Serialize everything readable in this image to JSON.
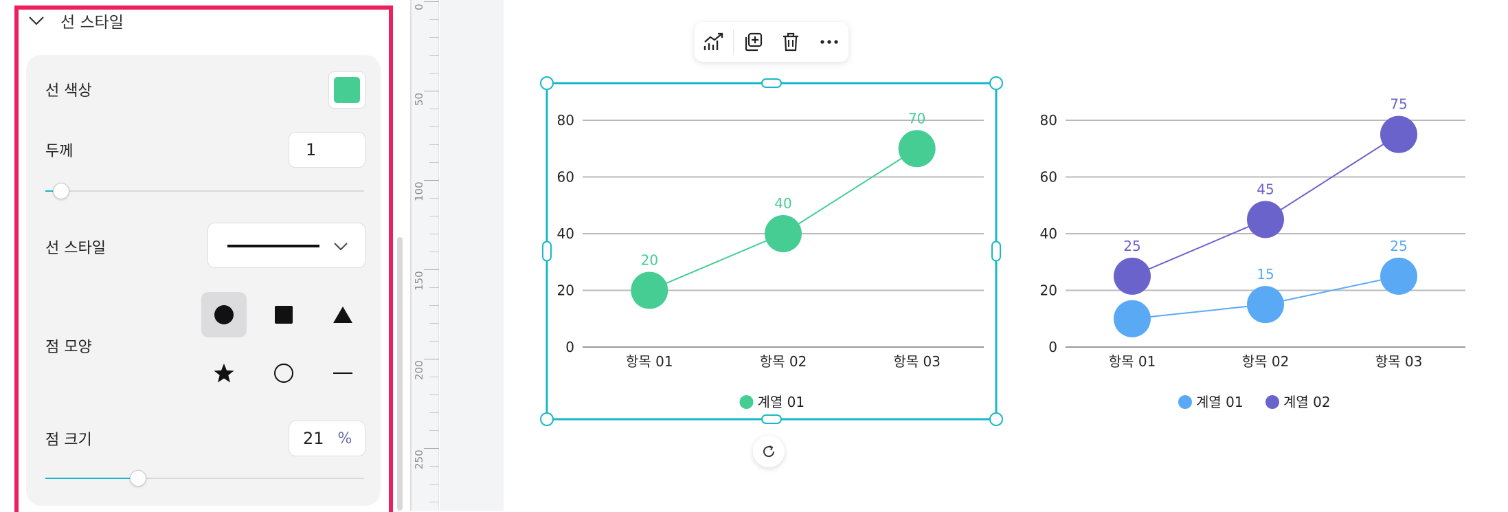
{
  "panel": {
    "section_title": "선 스타일",
    "line_color": {
      "label": "선 색상",
      "value": "#45cd94"
    },
    "thickness": {
      "label": "두께",
      "value": "1",
      "slider_fraction": 0.05
    },
    "line_style": {
      "label": "선 스타일",
      "value": "solid"
    },
    "point_shape": {
      "label": "점 모양",
      "selected": "circle",
      "options": [
        "circle-icon",
        "square-icon",
        "triangle-icon",
        "star-icon",
        "ring-icon",
        "dash-icon"
      ]
    },
    "point_size": {
      "label": "점 크기",
      "value": "21",
      "unit": "%",
      "slider_fraction": 0.29
    }
  },
  "ruler": {
    "labels": [
      "0",
      "50",
      "100",
      "150",
      "200",
      "250"
    ]
  },
  "toolbar": {
    "buttons": [
      "chart-type-icon",
      "duplicate-icon",
      "delete-icon",
      "more-icon"
    ]
  },
  "colors": {
    "accent": "#19b7c9",
    "highlight": "#ee1f5f",
    "series_green": "#45cd94",
    "series_blue": "#5aa9f5",
    "series_purple": "#6a63cc"
  },
  "chart_data": [
    {
      "type": "line",
      "categories": [
        "항목 01",
        "항목 02",
        "항목 03"
      ],
      "series": [
        {
          "name": "계열 01",
          "values": [
            20,
            40,
            70
          ],
          "color": "#45cd94"
        }
      ],
      "ylim": [
        0,
        80
      ],
      "yticks": [
        0,
        20,
        40,
        60,
        80
      ],
      "grid": true,
      "legend": "bottom",
      "selected": true
    },
    {
      "type": "line",
      "categories": [
        "항목 01",
        "항목 02",
        "항목 03"
      ],
      "series": [
        {
          "name": "계열 01",
          "values": [
            10,
            15,
            25
          ],
          "color": "#5aa9f5"
        },
        {
          "name": "계열 02",
          "values": [
            25,
            45,
            75
          ],
          "color": "#6a63cc"
        }
      ],
      "ylim": [
        0,
        80
      ],
      "yticks": [
        0,
        20,
        40,
        60,
        80
      ],
      "grid": true,
      "legend": "bottom"
    }
  ]
}
